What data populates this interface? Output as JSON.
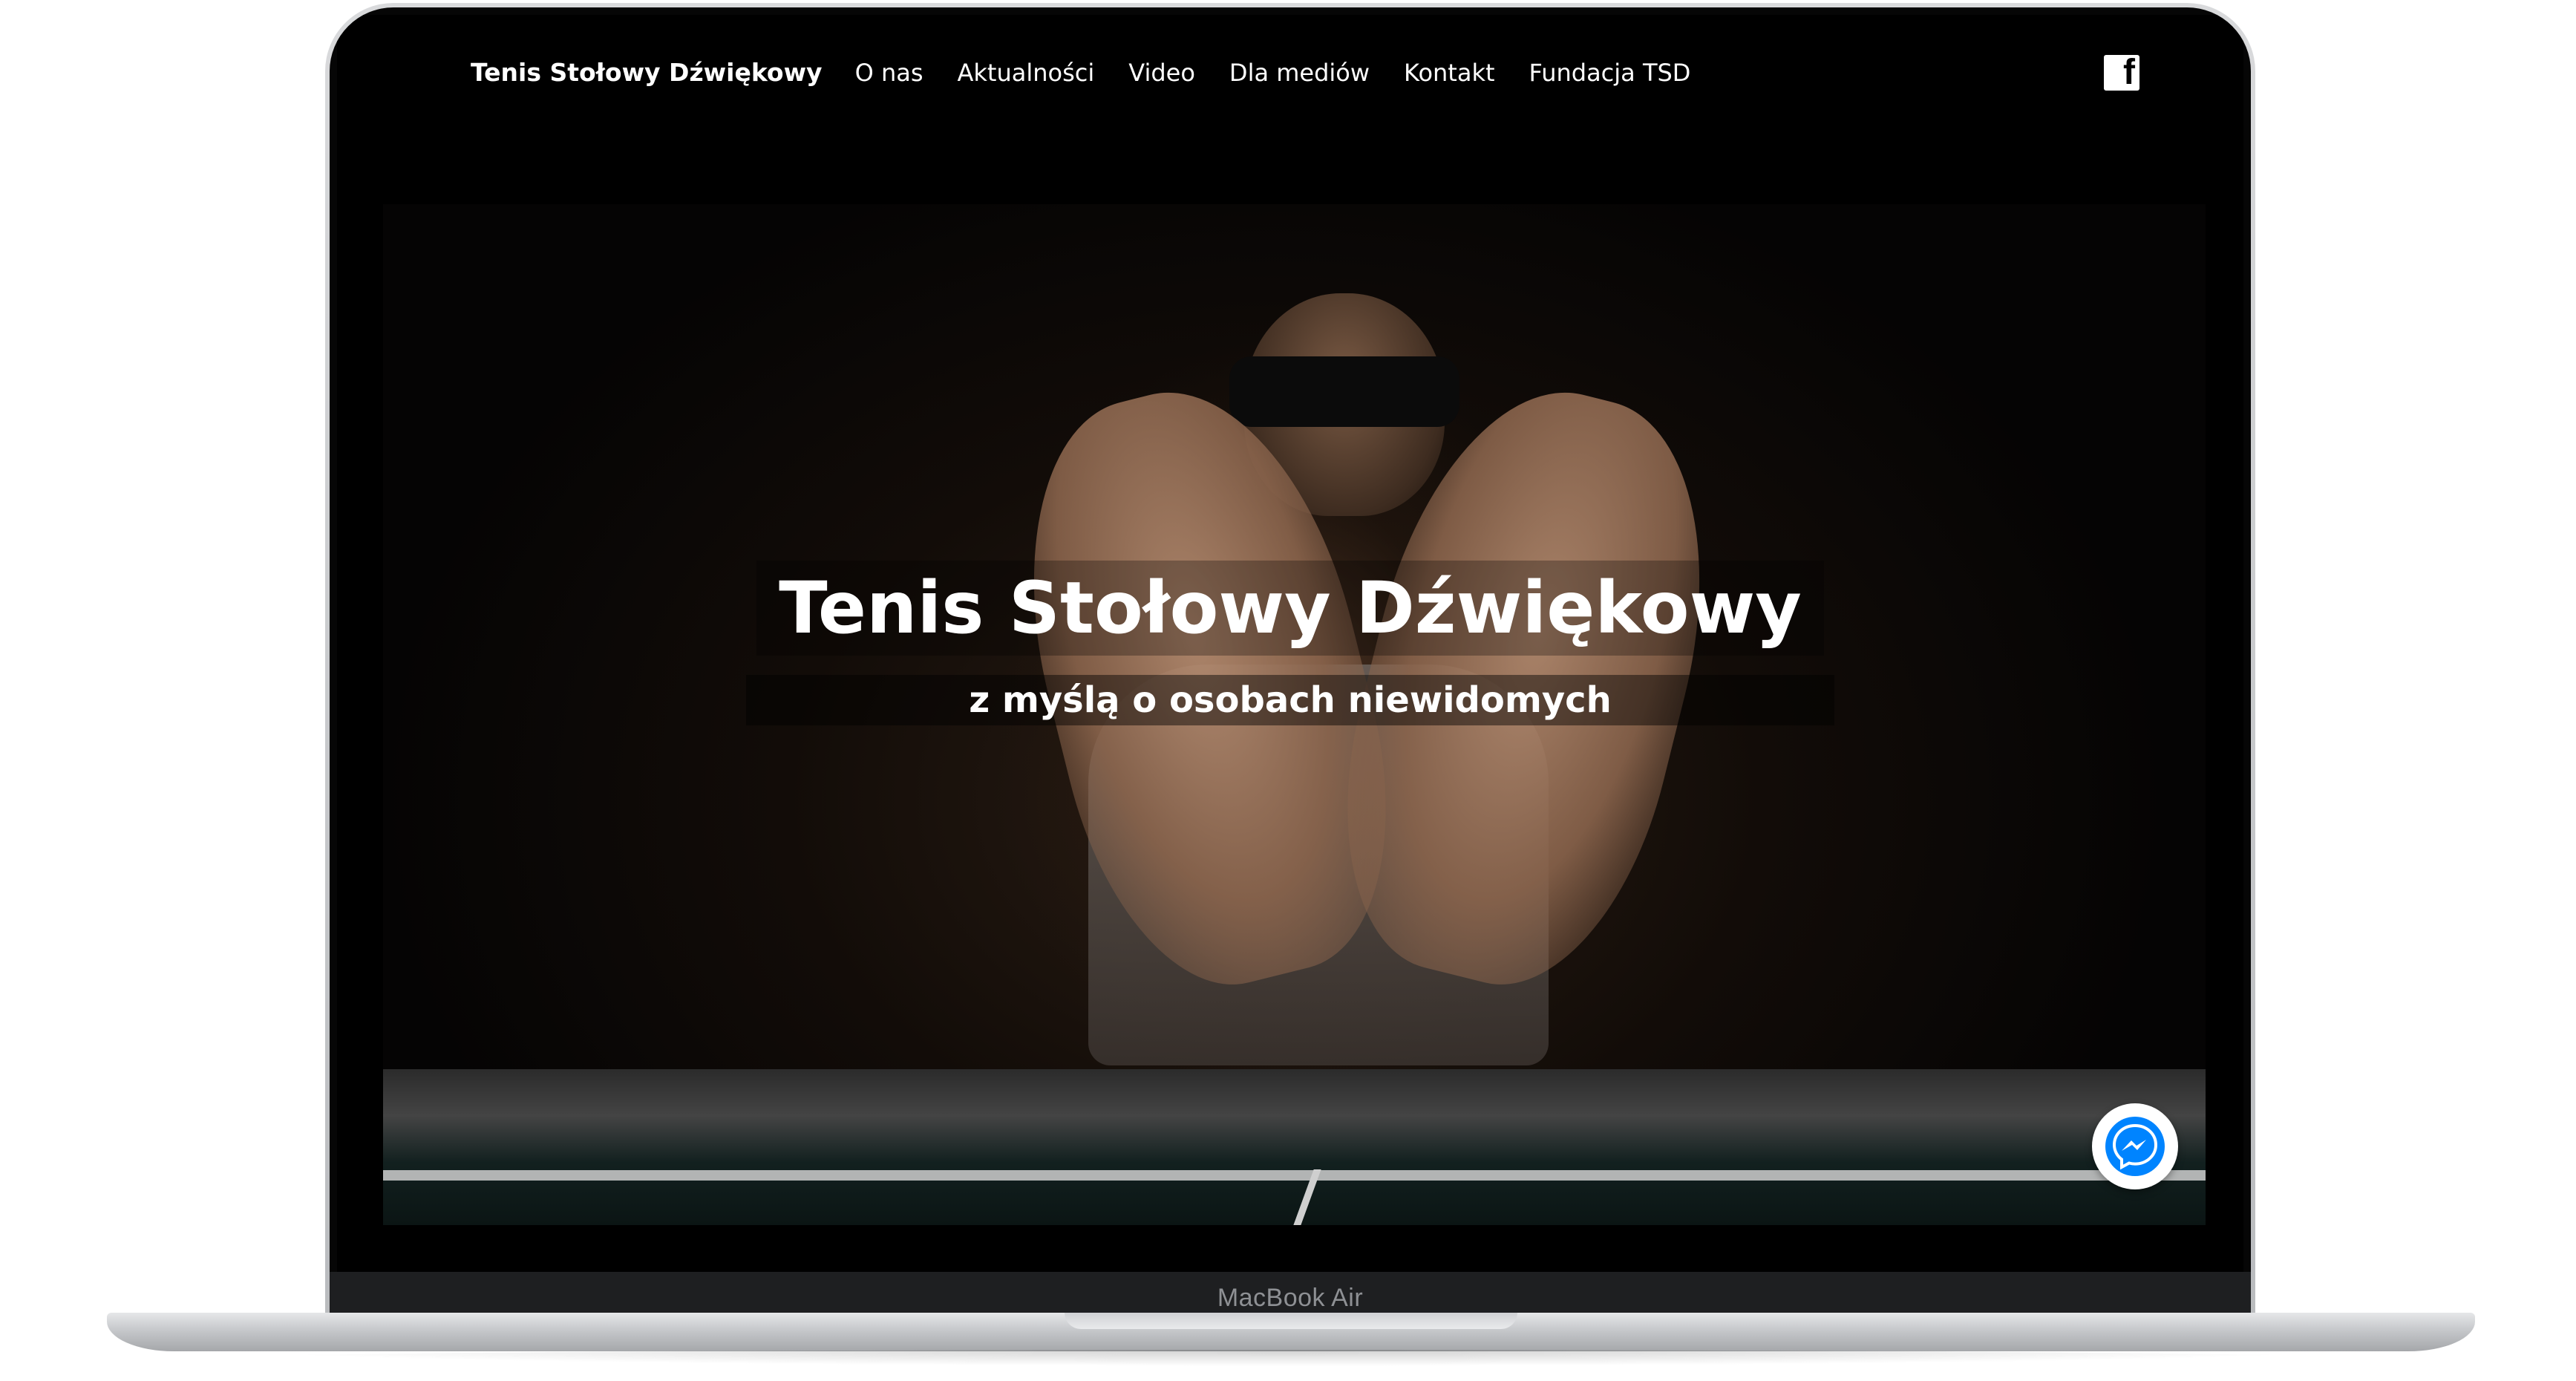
{
  "device": {
    "label": "MacBook Air"
  },
  "nav": {
    "brand": "Tenis Stołowy Dźwiękowy",
    "items": [
      {
        "label": "O nas"
      },
      {
        "label": "Aktualności"
      },
      {
        "label": "Video"
      },
      {
        "label": "Dla mediów"
      },
      {
        "label": "Kontakt"
      },
      {
        "label": "Fundacja TSD"
      }
    ],
    "social_icon": "facebook-icon"
  },
  "hero": {
    "title": "Tenis Stołowy Dźwiękowy",
    "subtitle": "z myślą o osobach niewidomych"
  },
  "chat": {
    "icon": "messenger-icon",
    "color": "#0084ff"
  }
}
